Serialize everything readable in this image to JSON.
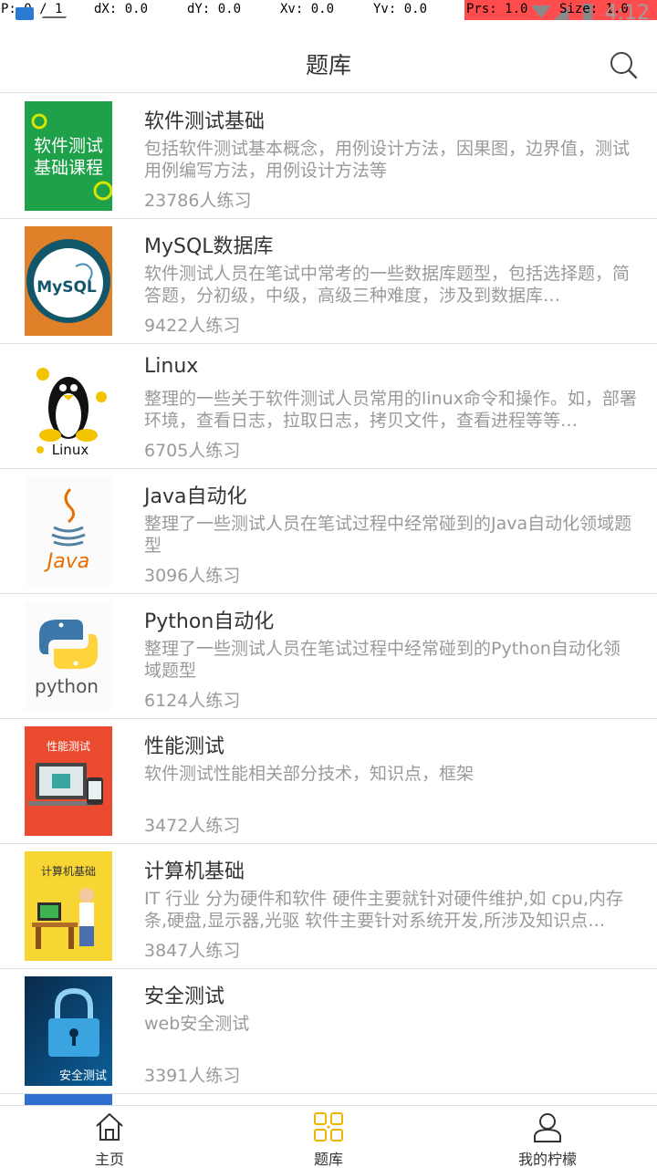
{
  "status_bar": {
    "p": "P: 0 / 1",
    "dx": "dX: 0.0",
    "dy": "dY: 0.0",
    "xv": "Xv: 0.0",
    "yv": "Yv: 0.0",
    "prs": "Prs: 1.0",
    "size": "Size: 1.0",
    "time": "4:12"
  },
  "header": {
    "title": "题库",
    "search_icon": "search-icon"
  },
  "items": [
    {
      "title": "软件测试基础",
      "desc": "包括软件测试基本概念，用例设计方法，因果图，边界值，测试用例编写方法，用例设计方法等",
      "count": "23786人练习",
      "thumb_text": "软件测试",
      "thumb_text2": "基础课程"
    },
    {
      "title": "MySQL数据库",
      "desc": "软件测试人员在笔试中常考的一些数据库题型，包括选择题，简答题，分初级，中级，高级三种难度，涉及到数据库…",
      "count": "9422人练习",
      "thumb_text": "MySQL"
    },
    {
      "title": "Linux",
      "desc": "整理的一些关于软件测试人员常用的linux命令和操作。如，部署环境，查看日志，拉取日志，拷贝文件，查看进程等等…",
      "count": "6705人练习",
      "thumb_text": "Linux"
    },
    {
      "title": "Java自动化",
      "desc": "整理了一些测试人员在笔试过程中经常碰到的Java自动化领域题型",
      "count": "3096人练习",
      "thumb_text": "Java"
    },
    {
      "title": "Python自动化",
      "desc": "整理了一些测试人员在笔试过程中经常碰到的Python自动化领域题型",
      "count": "6124人练习",
      "thumb_text": "python"
    },
    {
      "title": "性能测试",
      "desc": "软件测试性能相关部分技术，知识点，框架",
      "count": "3472人练习",
      "thumb_text": "性能测试"
    },
    {
      "title": "计算机基础",
      "desc": "IT 行业 分为硬件和软件 硬件主要就针对硬件维护,如 cpu,内存条,硬盘,显示器,光驱 软件主要针对系统开发,所涉及知识点…",
      "count": "3847人练习",
      "thumb_text": "计算机基础"
    },
    {
      "title": "安全测试",
      "desc": "web安全测试",
      "count": "3391人练习",
      "thumb_text": "安全测试"
    }
  ],
  "bottom_nav": [
    {
      "label": "主页",
      "icon": "home-icon"
    },
    {
      "label": "题库",
      "icon": "grid-icon",
      "active": true
    },
    {
      "label": "我的柠檬",
      "icon": "user-icon"
    }
  ],
  "colors": {
    "accent": "#f0b400",
    "text_primary": "#333333",
    "text_secondary": "#9a9a9a",
    "divider": "#e2e2e2"
  }
}
